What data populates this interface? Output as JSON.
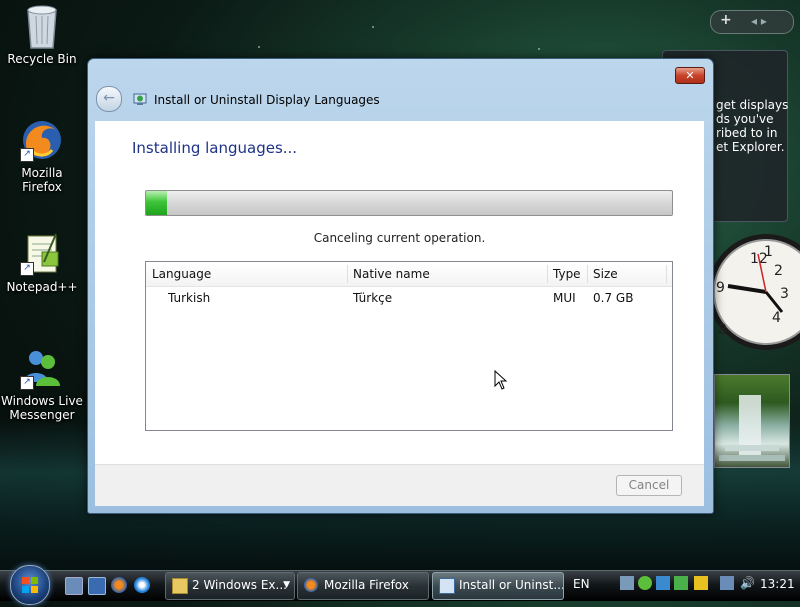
{
  "desktop": {
    "icons": [
      {
        "label": "Recycle Bin"
      },
      {
        "label": "Mozilla Firefox"
      },
      {
        "label": "Notepad++"
      },
      {
        "label": "Windows Live Messenger"
      }
    ]
  },
  "gadgets": {
    "feed_lines": [
      "get displays",
      "ds you've",
      "ribed to in",
      "et Explorer."
    ],
    "topbar_plus": "+",
    "topbar_arrows": "◂ ▸"
  },
  "dialog": {
    "title": "Install or Uninstall Display Languages",
    "heading": "Installing languages...",
    "progress_percent": 4,
    "status": "Canceling current operation.",
    "columns": [
      "Language",
      "Native name",
      "Type",
      "Size"
    ],
    "rows": [
      {
        "language": "Turkish",
        "native_name": "Türkçe",
        "type": "MUI",
        "size": "0.7 GB"
      }
    ],
    "cancel_label": "Cancel",
    "close_glyph": "✕",
    "back_glyph": "←"
  },
  "taskbar": {
    "buttons": [
      {
        "label": "2 Windows Ex...",
        "icon": "folder-icon"
      },
      {
        "label": "Mozilla Firefox",
        "icon": "firefox-icon"
      },
      {
        "label": "Install or Uninst...",
        "icon": "language-icon"
      }
    ],
    "language": "EN",
    "time": "13:21"
  },
  "colors": {
    "heading": "#1e3287",
    "progress_fill": "#1ea31a",
    "taskbar": "#12171a"
  }
}
